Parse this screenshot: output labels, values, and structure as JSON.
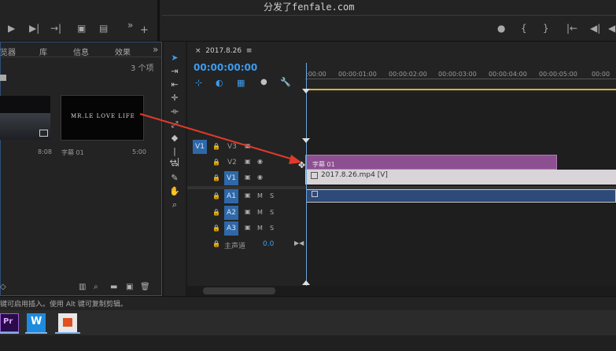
{
  "watermark": "分发了fenfale.com",
  "project_panel": {
    "tabs": [
      "览器",
      "库",
      "信息",
      "效果"
    ],
    "more": "»",
    "count": "3 个项",
    "items": [
      {
        "name": "",
        "duration": "8:08"
      },
      {
        "name": "字幕 01",
        "duration": "5:00",
        "preview_text": "MR.LE LOVE LIFE"
      }
    ]
  },
  "timeline": {
    "close": "×",
    "sequence_name": "2017.8.26",
    "menu": "≡",
    "timecode": "00:00:00:00",
    "ruler": [
      ":00:00",
      "00:00:01:00",
      "00:00:02:00",
      "00:00:03:00",
      "00:00:04:00",
      "00:00:05:00",
      "00:00"
    ],
    "tracks": {
      "v_source": "V1",
      "v3": "V3",
      "v2": "V2",
      "v1": "V1",
      "a1": "A1",
      "a2": "A2",
      "a3": "A3",
      "master": "主声道",
      "master_level": "0.0",
      "m": "M",
      "s": "S"
    },
    "clips": {
      "caption": "字幕 01",
      "video": "2017.8.26.mp4 [V]"
    }
  },
  "status_bar": "键可启用插入。使用 Alt 键可复制剪辑。",
  "taskbar": [
    {
      "label": "Pr",
      "color": "#2a0a4a",
      "text_color": "#d9a8ff"
    },
    {
      "label": "W",
      "color": "#1d8be0",
      "text_color": "#ffffff"
    },
    {
      "label": "",
      "color": "#e8e8e8",
      "text_color": "#e05020"
    }
  ],
  "colors": {
    "accent": "#3d9cf0",
    "caption_clip": "#8c4f90",
    "audio_clip": "#2e4a78",
    "track_tag": "#2f68a8"
  }
}
